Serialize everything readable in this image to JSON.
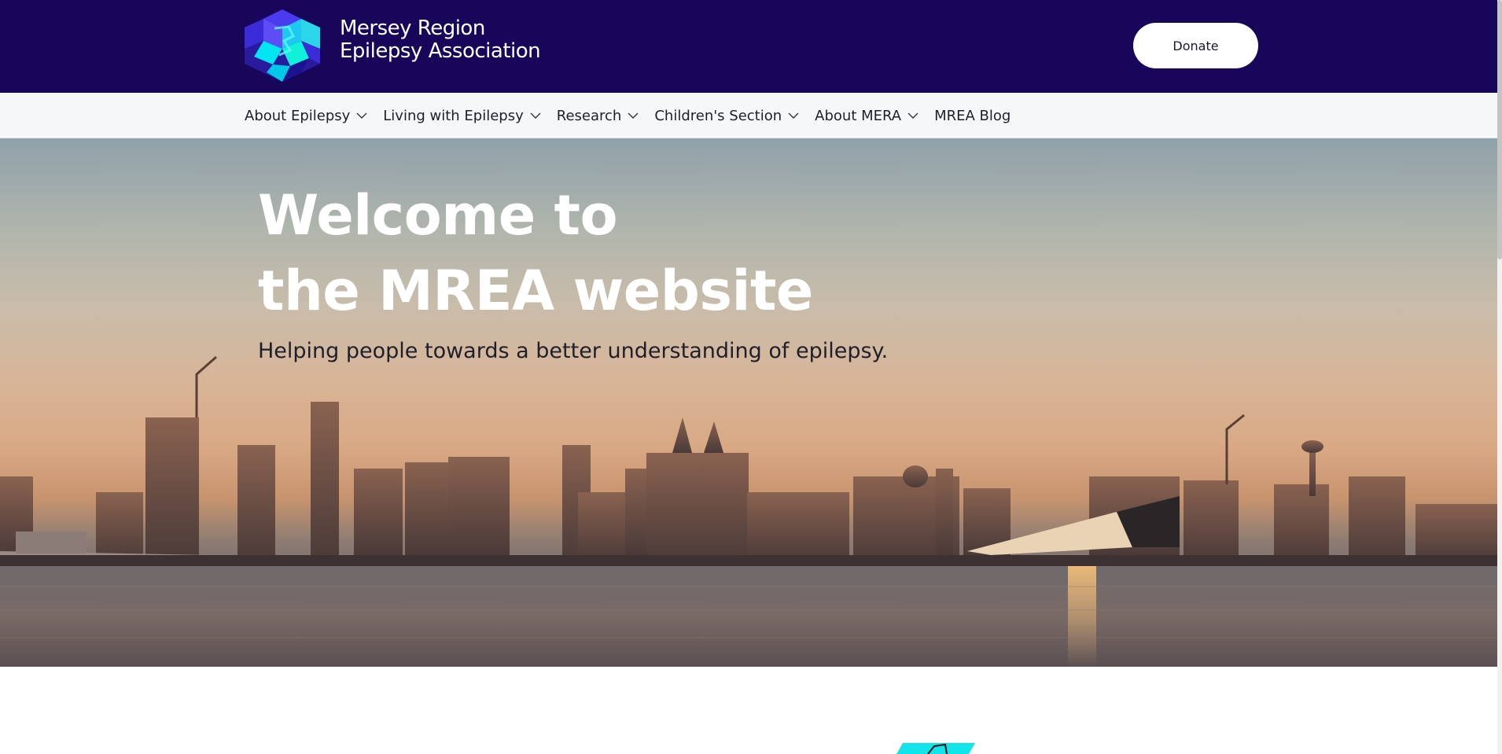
{
  "header": {
    "logo_icon": "hexagon-brain-logo-icon",
    "org_name_line1": "Mersey Region",
    "org_name_line2": "Epilepsy Association",
    "donate_label": "Donate",
    "colors": {
      "background": "#17065a",
      "logo_primary": "#00e5f0",
      "logo_secondary": "#3b2bd9"
    }
  },
  "nav": {
    "items": [
      {
        "label": "About Epilepsy",
        "has_dropdown": true
      },
      {
        "label": "Living with Epilepsy",
        "has_dropdown": true
      },
      {
        "label": "Research",
        "has_dropdown": true
      },
      {
        "label": "Children's Section",
        "has_dropdown": true
      },
      {
        "label": "About MERA",
        "has_dropdown": true
      },
      {
        "label": "MREA Blog",
        "has_dropdown": false
      }
    ]
  },
  "hero": {
    "title_line1": "Welcome to",
    "title_line2": "the MREA website",
    "subtitle": "Helping people towards a better understanding of epilepsy.",
    "image": "liverpool-waterfront-skyline-image"
  }
}
